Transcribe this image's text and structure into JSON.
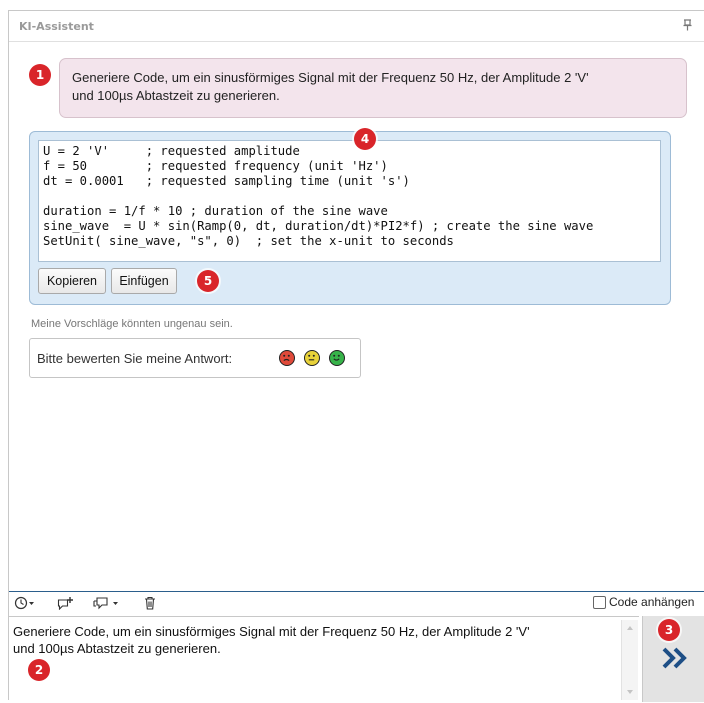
{
  "panel": {
    "title": "KI-Assistent",
    "pin_icon": "pin-icon"
  },
  "chat": {
    "user_message_lines": [
      "Generiere Code, um ein sinusförmiges Signal mit der Frequenz 50 Hz, der Amplitude 2 'V'",
      "und 100µs Abtastzeit zu generieren."
    ],
    "code_lines": [
      "U = 2 'V'     ; requested amplitude",
      "f = 50        ; requested frequency (unit 'Hz')",
      "dt = 0.0001   ; requested sampling time (unit 's')",
      "",
      "duration = 1/f * 10 ; duration of the sine wave",
      "sine_wave  = U * sin(Ramp(0, dt, duration/dt)*PI2*f) ; create the sine wave",
      "SetUnit( sine_wave, \"s\", 0)  ; set the x-unit to seconds"
    ],
    "copy_button": "Kopieren",
    "insert_button": "Einfügen",
    "hint": "Meine Vorschläge könnten ungenau sein.",
    "rating_label": "Bitte bewerten Sie meine Antwort:",
    "faces": [
      {
        "name": "sad-face-icon",
        "color": "#e04a3a"
      },
      {
        "name": "neutral-face-icon",
        "color": "#e8d23a"
      },
      {
        "name": "happy-face-icon",
        "color": "#37b34a"
      }
    ]
  },
  "input": {
    "toolbar_icons": [
      "history-icon",
      "new-chat-icon",
      "chat-options-icon",
      "delete-icon"
    ],
    "attach_code_label": "Code anhängen",
    "text_lines": [
      "Generiere Code, um ein sinusförmiges Signal mit der Frequenz 50 Hz, der Amplitude 2 'V'",
      "und 100µs Abtastzeit zu generieren."
    ],
    "send_icon": "send-icon"
  },
  "badges": [
    "1",
    "2",
    "3",
    "4",
    "5"
  ],
  "colors": {
    "badge": "#d9252a",
    "user_bubble": "#f3e4ec",
    "code_box": "#dbeaf7",
    "send_arrow": "#1e4f86",
    "divider": "#2b5e8c"
  }
}
